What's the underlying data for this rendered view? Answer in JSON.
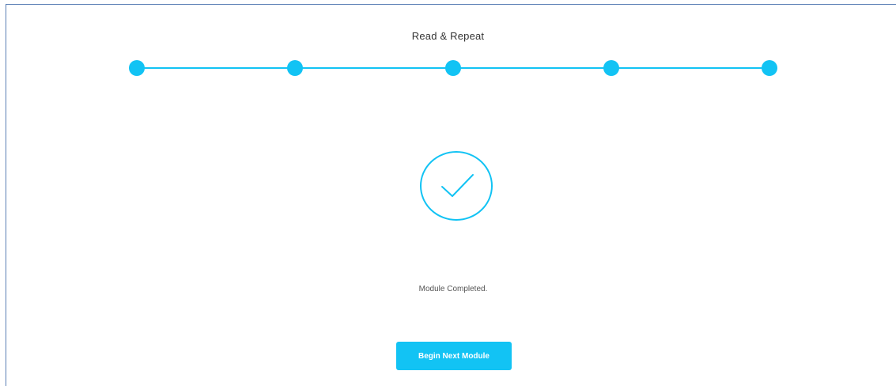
{
  "module": {
    "title": "Read & Repeat",
    "status_text": "Module Completed.",
    "next_button_label": "Begin Next Module"
  },
  "progress": {
    "total_steps": 5,
    "completed_steps": 5
  },
  "icons": {
    "completion": "checkmark-circle-icon"
  },
  "colors": {
    "accent": "#12c3f4",
    "text": "#333333",
    "muted_text": "#555555",
    "frame_border": "#5a7fb5"
  }
}
